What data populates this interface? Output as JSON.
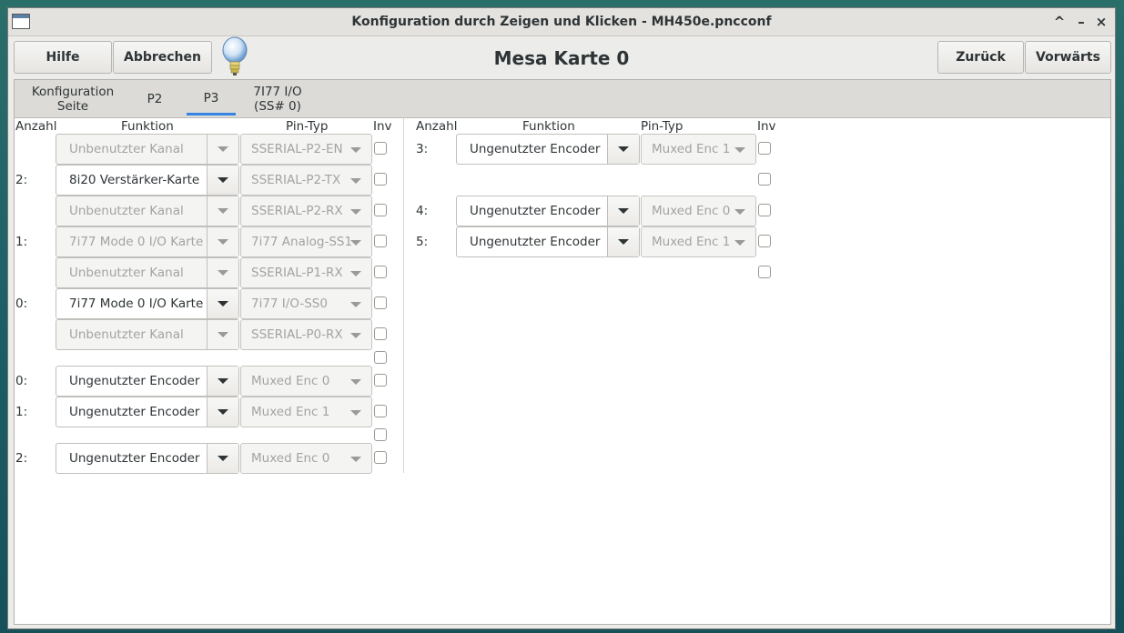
{
  "window": {
    "title": "Konfiguration durch Zeigen und Klicken - MH450e.pncconf",
    "controls": {
      "minimize": "^",
      "maximize": "–",
      "close": "×"
    }
  },
  "toolbar": {
    "help": "Hilfe",
    "cancel": "Abbrechen",
    "back": "Zurück",
    "forward": "Vorwärts",
    "heading": "Mesa Karte 0"
  },
  "tabs": [
    {
      "label": "Konfiguration\nSeite",
      "active": false
    },
    {
      "label": "P2",
      "active": false
    },
    {
      "label": "P3",
      "active": true
    },
    {
      "label": "7I77 I/O\n(SS# 0)",
      "active": false
    }
  ],
  "columns": {
    "count": "Anzahl",
    "function": "Funktion",
    "pin_type": "Pin-Typ",
    "inv": "Inv"
  },
  "left_rows": [
    {
      "count": "",
      "function": "Unbenutzter Kanal",
      "function_enabled": false,
      "pin": "SSERIAL-P2-EN"
    },
    {
      "count": "2:",
      "function": "8i20 Verstärker-Karte",
      "function_enabled": true,
      "pin": "SSERIAL-P2-TX"
    },
    {
      "count": "",
      "function": "Unbenutzter Kanal",
      "function_enabled": false,
      "pin": "SSERIAL-P2-RX"
    },
    {
      "count": "1:",
      "function": "7i77 Mode 0 I/O Karte",
      "function_enabled": false,
      "pin": "7i77 Analog-SS1"
    },
    {
      "count": "",
      "function": "Unbenutzter Kanal",
      "function_enabled": false,
      "pin": "SSERIAL-P1-RX"
    },
    {
      "count": "0:",
      "function": "7i77 Mode 0 I/O Karte",
      "function_enabled": true,
      "pin": "7i77 I/O-SS0"
    },
    {
      "count": "",
      "function": "Unbenutzter Kanal",
      "function_enabled": false,
      "pin": "SSERIAL-P0-RX"
    },
    {
      "count": "0:",
      "function": "Ungenutzter Encoder",
      "function_enabled": true,
      "pin": "Muxed Enc 0"
    },
    {
      "count": "1:",
      "function": "Ungenutzter Encoder",
      "function_enabled": true,
      "pin": "Muxed Enc 1"
    },
    {
      "count": "2:",
      "function": "Ungenutzter Encoder",
      "function_enabled": true,
      "pin": "Muxed Enc 0"
    }
  ],
  "right_rows": [
    {
      "count": "3:",
      "function": "Ungenutzter Encoder",
      "function_enabled": true,
      "pin": "Muxed Enc 1"
    },
    {
      "count": "4:",
      "function": "Ungenutzter Encoder",
      "function_enabled": true,
      "pin": "Muxed Enc 0"
    },
    {
      "count": "5:",
      "function": "Ungenutzter Encoder",
      "function_enabled": true,
      "pin": "Muxed Enc 1"
    }
  ]
}
